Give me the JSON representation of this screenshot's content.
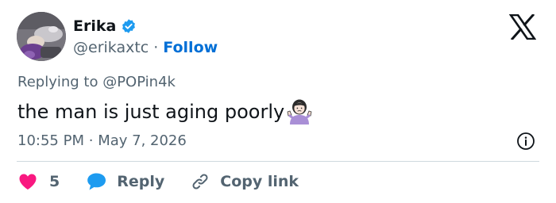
{
  "author": {
    "display_name": "Erika",
    "handle": "@erikaxtc",
    "separator": "·",
    "follow_label": "Follow",
    "verified_color": "#1d9bf0"
  },
  "reply_context": {
    "prefix": "Replying to ",
    "mention": "@POPin4k"
  },
  "tweet": {
    "text": "the man is just aging poorly",
    "emoji": "person-shrugging-emoji"
  },
  "timestamp": {
    "time": "10:55 PM",
    "separator": "·",
    "date": "May 7, 2026"
  },
  "actions": {
    "like_count": "5",
    "reply_label": "Reply",
    "copy_label": "Copy link"
  },
  "colors": {
    "text": "#0f1419",
    "secondary": "#536471",
    "link": "#006fd6",
    "heart": "#f91880",
    "reply_bubble": "#1d9bf0",
    "divider": "#cfd9de"
  },
  "icons": {
    "brand": "x-logo-icon",
    "info": "info-icon",
    "like": "heart-icon",
    "reply": "speech-bubble-icon",
    "copy": "link-icon"
  }
}
